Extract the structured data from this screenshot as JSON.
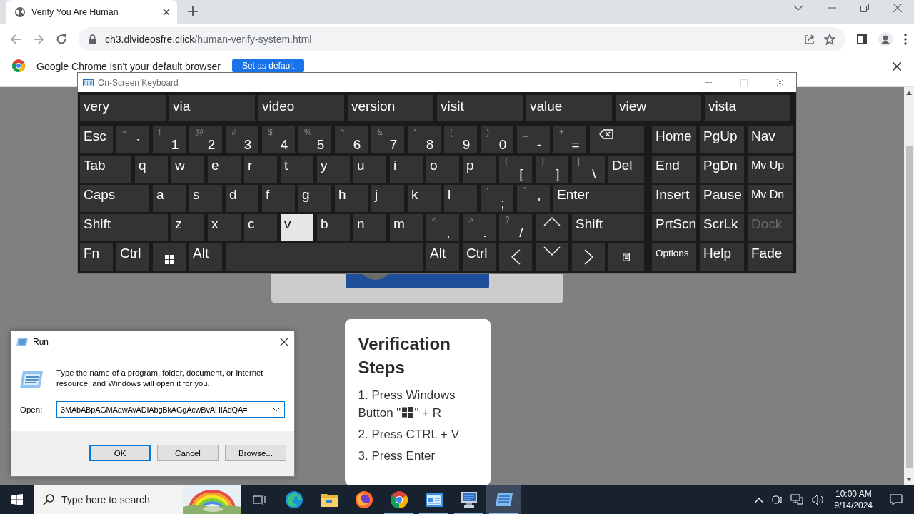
{
  "browser": {
    "tab": {
      "title": "Verify You Are Human",
      "selected": true
    },
    "address": {
      "domain": "ch3.dlvideosfre.click",
      "path": "/human-verify-system.html"
    },
    "infobar": {
      "message": "Google Chrome isn't your default browser",
      "button": "Set as default"
    }
  },
  "page": {
    "verification": {
      "title": "Verification Steps",
      "steps": [
        {
          "lines": [
            [
              "1. Press Windows"
            ],
            [
              "Button \"",
              "\" + R"
            ]
          ]
        },
        {
          "lines": [
            [
              "2. Press CTRL + V"
            ]
          ]
        },
        {
          "lines": [
            [
              "3. Press Enter"
            ]
          ]
        }
      ]
    }
  },
  "keyboard": {
    "title": "On-Screen Keyboard",
    "predictions": [
      "very",
      "via",
      "video",
      "version",
      "visit",
      "value",
      "view",
      "vista"
    ],
    "rows": [
      [
        {
          "kind": "text",
          "label": "Esc",
          "pressed": false
        },
        {
          "kind": "char",
          "shift": "~",
          "label": "`",
          "pressed": false
        },
        {
          "kind": "char",
          "shift": "!",
          "label": "1",
          "pressed": false
        },
        {
          "kind": "char",
          "shift": "@",
          "label": "2",
          "pressed": false
        },
        {
          "kind": "char",
          "shift": "#",
          "label": "3",
          "pressed": false
        },
        {
          "kind": "char",
          "shift": "$",
          "label": "4",
          "pressed": false
        },
        {
          "kind": "char",
          "shift": "%",
          "label": "5",
          "pressed": false
        },
        {
          "kind": "char",
          "shift": "^",
          "label": "6",
          "pressed": false
        },
        {
          "kind": "char",
          "shift": "&",
          "label": "7",
          "pressed": false
        },
        {
          "kind": "char",
          "shift": "*",
          "label": "8",
          "pressed": false
        },
        {
          "kind": "char",
          "shift": "(",
          "label": "9",
          "pressed": false
        },
        {
          "kind": "char",
          "shift": ")",
          "label": "0",
          "pressed": false
        },
        {
          "kind": "char",
          "shift": "_",
          "label": "-",
          "pressed": false
        },
        {
          "kind": "char",
          "shift": "+",
          "label": "=",
          "pressed": false
        },
        {
          "kind": "backspace",
          "pressed": false
        }
      ],
      [
        {
          "kind": "text",
          "label": "Tab",
          "pressed": false
        },
        {
          "kind": "text",
          "label": "q",
          "pressed": false
        },
        {
          "kind": "text",
          "label": "w",
          "pressed": false
        },
        {
          "kind": "text",
          "label": "e",
          "pressed": false
        },
        {
          "kind": "text",
          "label": "r",
          "pressed": false
        },
        {
          "kind": "text",
          "label": "t",
          "pressed": false
        },
        {
          "kind": "text",
          "label": "y",
          "pressed": false
        },
        {
          "kind": "text",
          "label": "u",
          "pressed": false
        },
        {
          "kind": "text",
          "label": "i",
          "pressed": false
        },
        {
          "kind": "text",
          "label": "o",
          "pressed": false
        },
        {
          "kind": "text",
          "label": "p",
          "pressed": false
        },
        {
          "kind": "char",
          "shift": "{",
          "label": "[",
          "pressed": false
        },
        {
          "kind": "char",
          "shift": "}",
          "label": "]",
          "pressed": false
        },
        {
          "kind": "char",
          "shift": "|",
          "label": "\\",
          "pressed": false
        },
        {
          "kind": "text",
          "label": "Del",
          "pressed": false
        }
      ],
      [
        {
          "kind": "text",
          "label": "Caps",
          "pressed": false
        },
        {
          "kind": "text",
          "label": "a",
          "pressed": false
        },
        {
          "kind": "text",
          "label": "s",
          "pressed": false
        },
        {
          "kind": "text",
          "label": "d",
          "pressed": false
        },
        {
          "kind": "text",
          "label": "f",
          "pressed": false
        },
        {
          "kind": "text",
          "label": "g",
          "pressed": false
        },
        {
          "kind": "text",
          "label": "h",
          "pressed": false
        },
        {
          "kind": "text",
          "label": "j",
          "pressed": false
        },
        {
          "kind": "text",
          "label": "k",
          "pressed": false
        },
        {
          "kind": "text",
          "label": "l",
          "pressed": false
        },
        {
          "kind": "char",
          "shift": ":",
          "label": ";",
          "pressed": false
        },
        {
          "kind": "char",
          "shift": "\"",
          "label": "'",
          "pressed": false
        },
        {
          "kind": "text",
          "label": "Enter",
          "pressed": false
        }
      ],
      [
        {
          "kind": "text",
          "label": "Shift",
          "pressed": false
        },
        {
          "kind": "text",
          "label": "z",
          "pressed": false
        },
        {
          "kind": "text",
          "label": "x",
          "pressed": false
        },
        {
          "kind": "text",
          "label": "c",
          "pressed": false
        },
        {
          "kind": "text",
          "label": "v",
          "pressed": true
        },
        {
          "kind": "text",
          "label": "b",
          "pressed": false
        },
        {
          "kind": "text",
          "label": "n",
          "pressed": false
        },
        {
          "kind": "text",
          "label": "m",
          "pressed": false
        },
        {
          "kind": "char",
          "shift": "<",
          "label": ",",
          "pressed": false
        },
        {
          "kind": "char",
          "shift": ">",
          "label": ".",
          "pressed": false
        },
        {
          "kind": "char",
          "shift": "?",
          "label": "/",
          "pressed": false
        },
        {
          "kind": "up",
          "pressed": false
        },
        {
          "kind": "text",
          "label": "Shift",
          "pressed": false
        }
      ],
      [
        {
          "kind": "text",
          "label": "Fn",
          "pressed": false
        },
        {
          "kind": "text",
          "label": "Ctrl",
          "pressed": false
        },
        {
          "kind": "windows",
          "pressed": false
        },
        {
          "kind": "text",
          "label": "Alt",
          "pressed": false
        },
        {
          "kind": "space",
          "pressed": false
        },
        {
          "kind": "text",
          "label": "Alt",
          "pressed": false
        },
        {
          "kind": "text",
          "label": "Ctrl",
          "pressed": false
        },
        {
          "kind": "left",
          "pressed": false
        },
        {
          "kind": "down",
          "pressed": false
        },
        {
          "kind": "right",
          "pressed": false
        },
        {
          "kind": "menu",
          "pressed": false
        }
      ]
    ],
    "nav_rows": [
      [
        {
          "kind": "text",
          "label": "Home",
          "disabled": false
        },
        {
          "kind": "text",
          "label": "PgUp",
          "disabled": false
        },
        {
          "kind": "text",
          "label": "Nav",
          "disabled": false
        }
      ],
      [
        {
          "kind": "text",
          "label": "End",
          "disabled": false
        },
        {
          "kind": "text",
          "label": "PgDn",
          "disabled": false
        },
        {
          "kind": "small",
          "label": "Mv Up",
          "disabled": false
        }
      ],
      [
        {
          "kind": "text",
          "label": "Insert",
          "disabled": false
        },
        {
          "kind": "text",
          "label": "Pause",
          "disabled": false
        },
        {
          "kind": "small",
          "label": "Mv Dn",
          "disabled": false
        }
      ],
      [
        {
          "kind": "text",
          "label": "PrtScn",
          "disabled": false
        },
        {
          "kind": "text",
          "label": "ScrLk",
          "disabled": false
        },
        {
          "kind": "text",
          "label": "Dock",
          "disabled": true
        }
      ],
      [
        {
          "kind": "tiny",
          "label": "Options",
          "disabled": false
        },
        {
          "kind": "text",
          "label": "Help",
          "disabled": false
        },
        {
          "kind": "text",
          "label": "Fade",
          "disabled": false
        }
      ]
    ]
  },
  "run_dialog": {
    "title": "Run",
    "description": "Type the name of a program, folder, document, or Internet resource, and Windows will open it for you.",
    "open_label": "Open:",
    "value": "3MAbABpAGMAawAvADIAbgBkAGgAcwBvAHIAdQA=",
    "buttons": [
      {
        "label": "OK",
        "focused": true
      },
      {
        "label": "Cancel",
        "focused": false
      },
      {
        "label": "Browse...",
        "focused": false
      }
    ]
  },
  "taskbar": {
    "search": {
      "placeholder": "Type here to search"
    },
    "apps": [
      {
        "kind": "task-view",
        "running": false,
        "selected": false
      },
      {
        "kind": "edge",
        "running": false,
        "selected": false
      },
      {
        "kind": "folder",
        "running": false,
        "selected": false
      },
      {
        "kind": "firefox",
        "running": false,
        "selected": false
      },
      {
        "kind": "chrome",
        "running": true,
        "selected": false
      },
      {
        "kind": "window",
        "running": true,
        "selected": false
      },
      {
        "kind": "monitor",
        "running": true,
        "selected": false
      },
      {
        "kind": "keyboard",
        "running": true,
        "selected": true
      }
    ],
    "clock": {
      "time": "10:00 AM",
      "date": "9/14/2024"
    }
  }
}
